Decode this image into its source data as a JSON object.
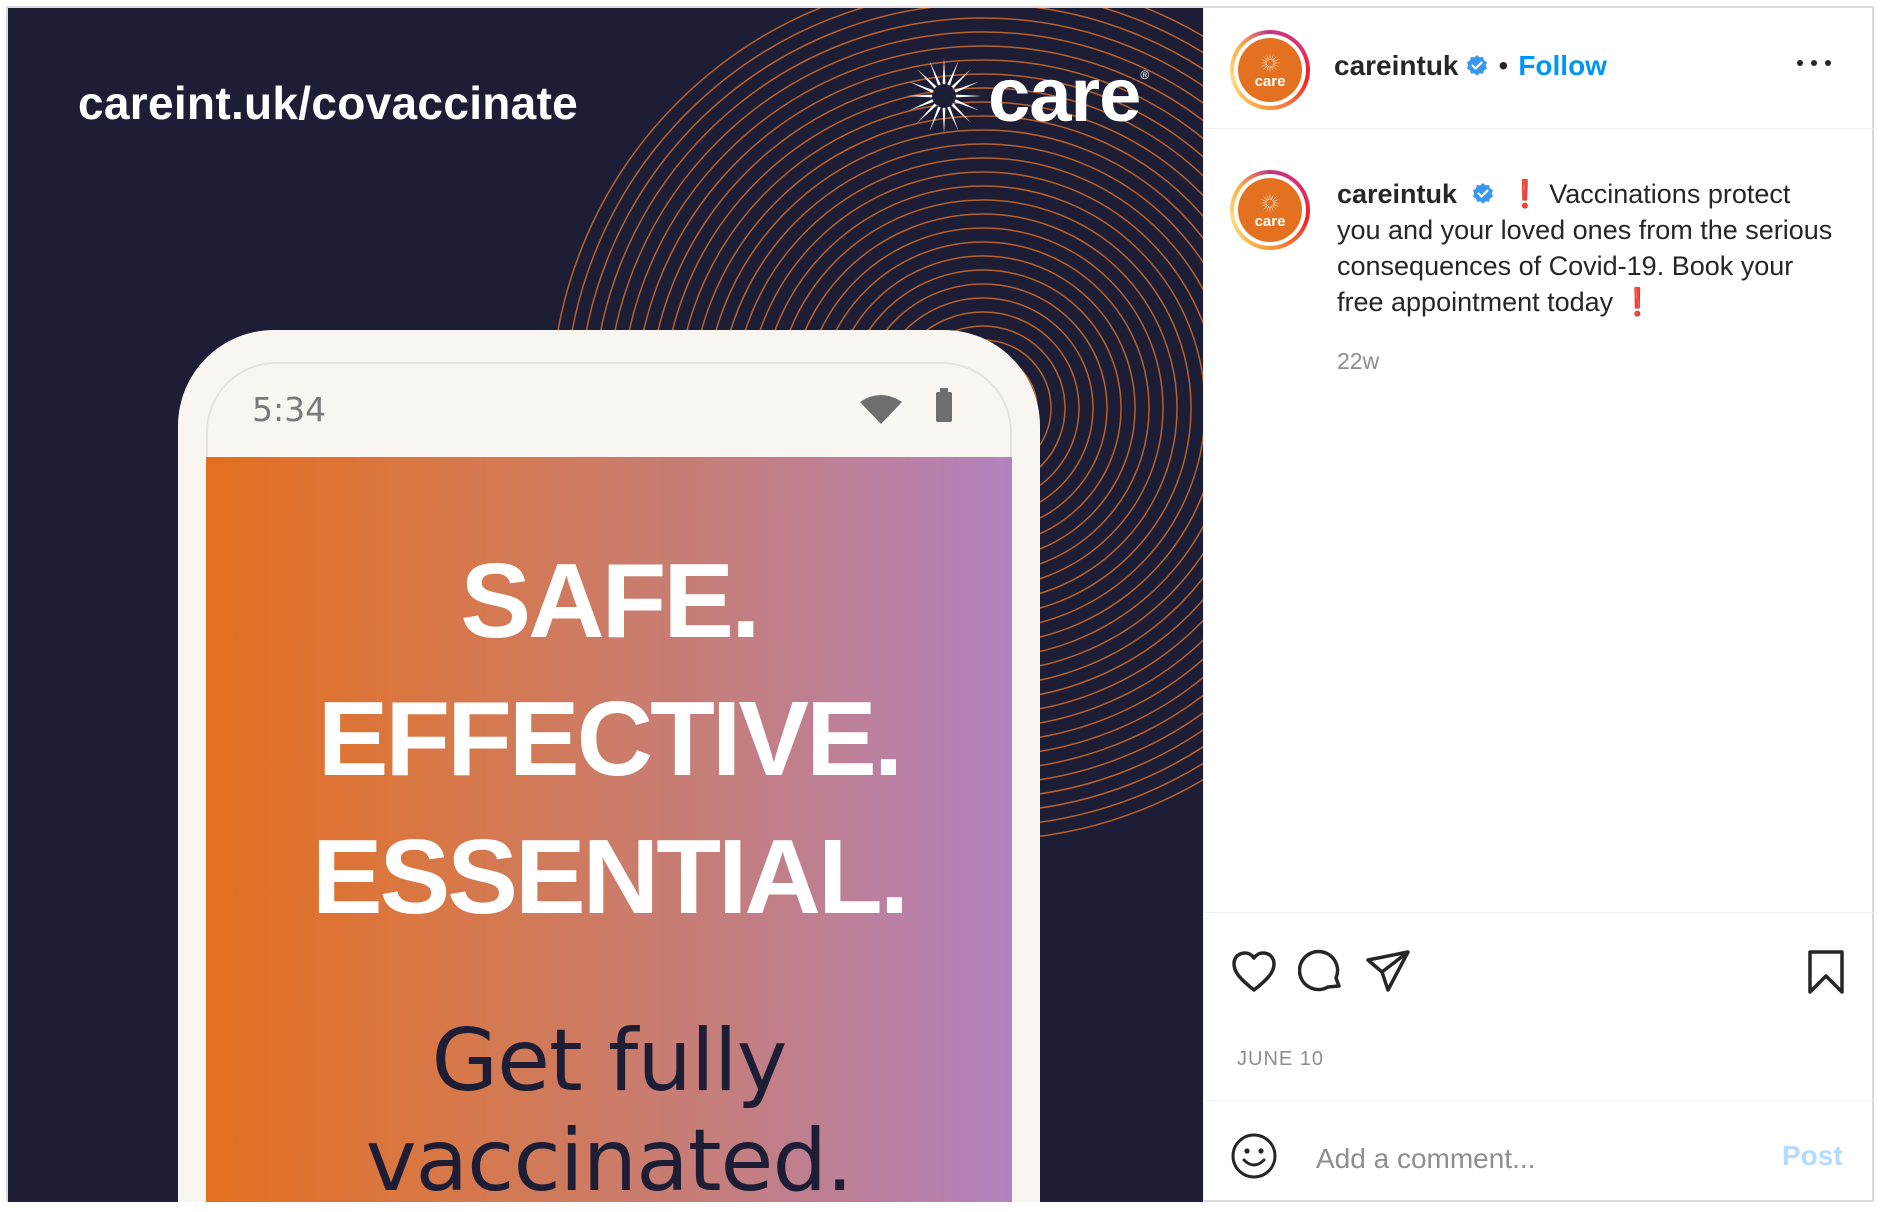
{
  "image": {
    "url": "careint.uk/covaccinate",
    "logo_text": "care",
    "logo_registered": "®",
    "phone_time": "5:34",
    "headlines": [
      "SAFE.",
      "EFFECTIVE.",
      "ESSENTIAL."
    ],
    "tagline": "Get fully vaccinated."
  },
  "header": {
    "avatar_text": "care",
    "username": "careintuk",
    "separator": "•",
    "follow_label": "Follow"
  },
  "caption": {
    "username": "careintuk",
    "exclaim_start": "❗",
    "text": "Vaccinations protect you and your loved ones from the serious consequences of Covid-19. Book your free appointment today",
    "exclaim_end": "❗",
    "time_ago": "22w"
  },
  "actions": {
    "icons": [
      "heart-icon",
      "comment-icon",
      "share-icon",
      "bookmark-icon"
    ],
    "date": "JUNE 10"
  },
  "comment": {
    "placeholder": "Add a comment...",
    "post_label": "Post"
  },
  "colors": {
    "image_bg": "#1d1d35",
    "accent_orange": "#e46f1f",
    "follow_blue": "#0095f6",
    "post_disabled": "#b3dbff"
  }
}
